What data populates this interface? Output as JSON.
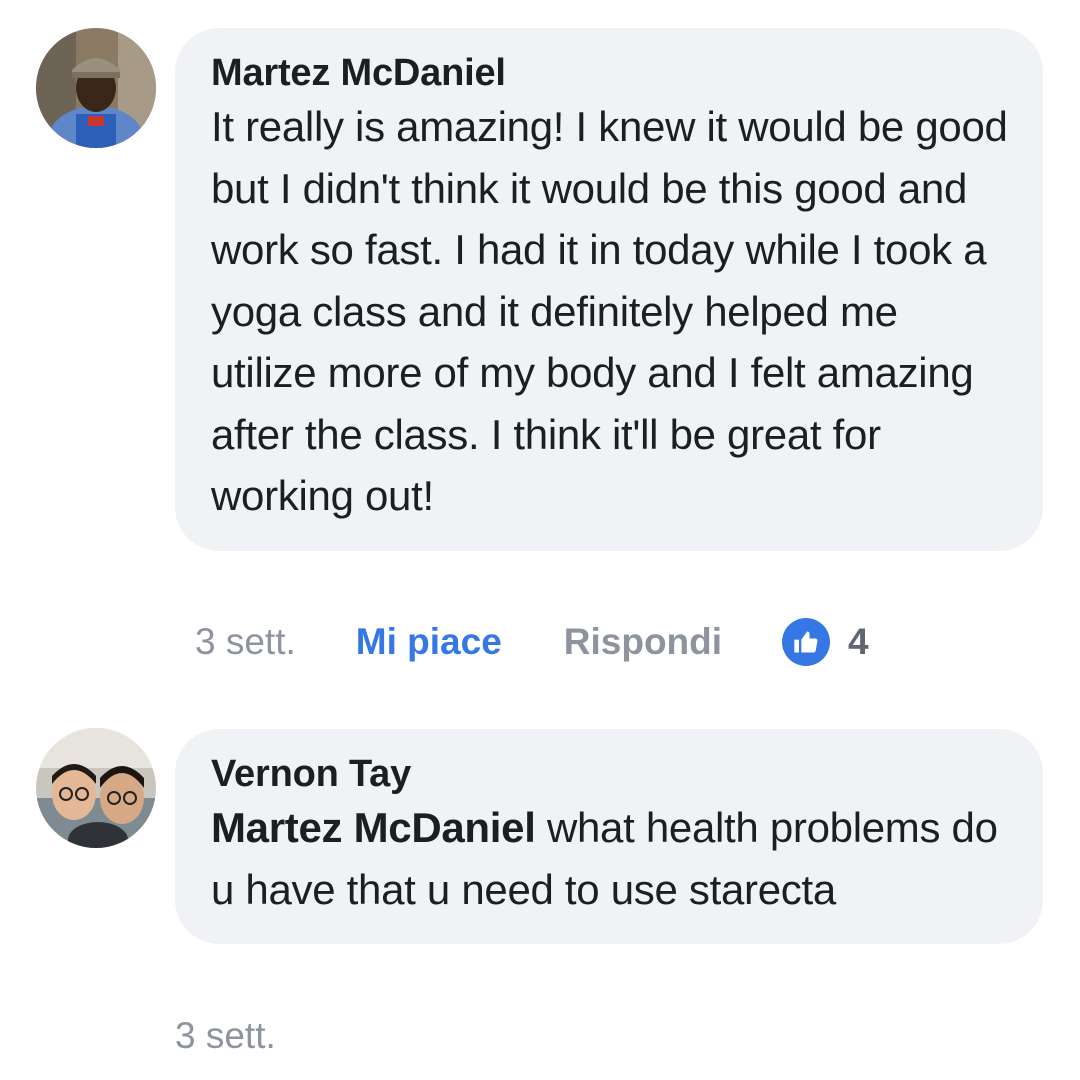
{
  "comments": [
    {
      "author": "Martez McDaniel",
      "mention": "",
      "text": "It really is amazing! I knew it would be good but I didn't think it would be this good and work so fast. I had it in today while I took a yoga class and it definitely helped me utilize more of my body and I felt amazing after the class. I think it'll be great for working out!",
      "time": "3 sett.",
      "like_label": "Mi piace",
      "reply_label": "Rispondi",
      "reaction_icon": "thumbs-up-icon",
      "reaction_count": "4"
    },
    {
      "author": "Vernon Tay",
      "mention": "Martez McDaniel",
      "text": " what health problems do u have that u need to use starecta",
      "time": "3 sett."
    }
  ],
  "colors": {
    "bubble": "#f0f2f5",
    "like_blue": "#3578e5",
    "meta_gray": "#8d949e",
    "text": "#1c1e21"
  }
}
